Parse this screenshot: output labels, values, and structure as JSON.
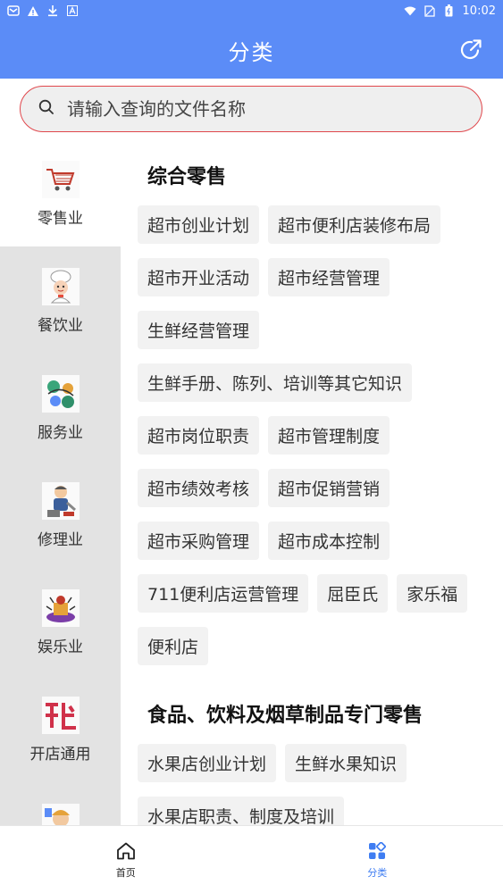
{
  "status_bar": {
    "time": "10:02",
    "left_icons": [
      "mail-icon",
      "warning-icon",
      "download-icon",
      "a-icon"
    ],
    "right_icons": [
      "wifi-icon",
      "sim-icon",
      "battery-icon"
    ]
  },
  "app_bar": {
    "title": "分类",
    "share_icon": "share-icon"
  },
  "search": {
    "placeholder": "请输入查询的文件名称",
    "icon": "search-icon"
  },
  "sidebar": {
    "items": [
      {
        "label": "零售业",
        "icon": "shopping-cart-icon",
        "active": true
      },
      {
        "label": "餐饮业",
        "icon": "chef-icon",
        "active": false
      },
      {
        "label": "服务业",
        "icon": "service-icon",
        "active": false
      },
      {
        "label": "修理业",
        "icon": "repairman-icon",
        "active": false
      },
      {
        "label": "娱乐业",
        "icon": "entertainment-icon",
        "active": false
      },
      {
        "label": "开店通用",
        "icon": "open-store-icon",
        "active": false
      },
      {
        "label": "",
        "icon": "person-icon",
        "active": false
      }
    ]
  },
  "sections": [
    {
      "title": "综合零售",
      "tags": [
        "超市创业计划",
        "超市便利店装修布局",
        "超市开业活动",
        "超市经营管理",
        "生鲜经营管理",
        "生鲜手册、陈列、培训等其它知识",
        "超市岗位职责",
        "超市管理制度",
        "超市绩效考核",
        "超市促销营销",
        "超市采购管理",
        "超市成本控制",
        "711便利店运营管理",
        "屈臣氏",
        "家乐福",
        "便利店"
      ]
    },
    {
      "title": "食品、饮料及烟草制品专门零售",
      "tags": [
        "水果店创业计划",
        "生鲜水果知识",
        "水果店职责、制度及培训"
      ]
    }
  ],
  "bottom_nav": {
    "home_label": "首页",
    "category_label": "分类",
    "active_color": "#3f7df2"
  },
  "colors": {
    "primary": "#5b8cf7",
    "search_border": "#e0474c",
    "sidebar_bg": "#e3e3e3"
  }
}
